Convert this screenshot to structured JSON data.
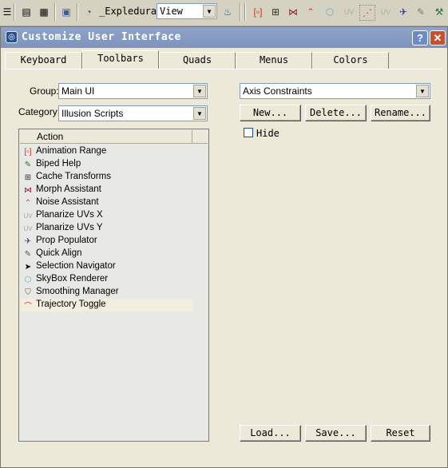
{
  "toolbar": {
    "explode_label": "_Expl",
    "edura_label": "edura",
    "view_value": "View"
  },
  "dialog": {
    "title": "Customize User Interface",
    "help_label": "?",
    "close_label": "✕",
    "tabs": [
      {
        "label": "Keyboard"
      },
      {
        "label": "Toolbars"
      },
      {
        "label": "Quads"
      },
      {
        "label": "Menus"
      },
      {
        "label": "Colors"
      }
    ],
    "group_label": "Group:",
    "group_value": "Main UI",
    "category_label": "Category:",
    "category_value": "Illusion Scripts",
    "action_header": "Action",
    "actions": [
      {
        "label": "Animation Range",
        "icon": "range-icon"
      },
      {
        "label": "Biped Help",
        "icon": "biped-icon"
      },
      {
        "label": "Cache Transforms",
        "icon": "cache-icon"
      },
      {
        "label": "Morph Assistant",
        "icon": "morph-icon"
      },
      {
        "label": "Noise Assistant",
        "icon": "noise-icon"
      },
      {
        "label": "Planarize UVs X",
        "icon": "uv-x-icon"
      },
      {
        "label": "Planarize UVs Y",
        "icon": "uv-y-icon"
      },
      {
        "label": "Prop Populator",
        "icon": "prop-icon"
      },
      {
        "label": "Quick Align",
        "icon": "align-icon"
      },
      {
        "label": "Selection Navigator",
        "icon": "pointer-icon"
      },
      {
        "label": "SkyBox Renderer",
        "icon": "skybox-icon"
      },
      {
        "label": "Smoothing Manager",
        "icon": "smoothing-icon"
      },
      {
        "label": "Trajectory Toggle",
        "icon": "trajectory-icon"
      }
    ],
    "toolbar_value": "Axis Constraints",
    "new_label": "New...",
    "delete_label": "Delete...",
    "rename_label": "Rename...",
    "hide_label": "Hide",
    "load_label": "Load...",
    "save_label": "Save...",
    "reset_label": "Reset"
  }
}
